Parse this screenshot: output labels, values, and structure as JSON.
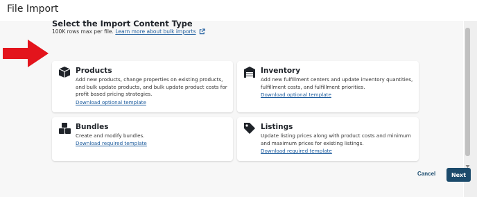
{
  "header": {
    "title": "File Import"
  },
  "section": {
    "title": "Select the Import Content Type",
    "note": "100K rows max per file.",
    "link": "Learn more about bulk imports"
  },
  "cards": [
    {
      "icon": "box-icon",
      "title": "Products",
      "desc": "Add new products, change properties on existing products, and bulk update products, and bulk update product costs for profit based pricing strategies.",
      "link": "Download optional template"
    },
    {
      "icon": "warehouse-icon",
      "title": "Inventory",
      "desc": "Add new fulfillment centers and update inventory quantities, fulfillment costs, and fulfillment priorities.",
      "link": "Download optional template"
    },
    {
      "icon": "boxes-icon",
      "title": "Bundles",
      "desc": "Create and modify bundles.",
      "link": "Download required template"
    },
    {
      "icon": "tag-icon",
      "title": "Listings",
      "desc": "Update listing prices along with product costs and minimum and maximum prices for existing listings.",
      "link": "Download required template"
    }
  ],
  "footer": {
    "cancel": "Cancel",
    "next": "Next"
  },
  "colors": {
    "accent": "#1b4a6b",
    "link": "#1a5a9c",
    "arrow": "#e3141c"
  }
}
